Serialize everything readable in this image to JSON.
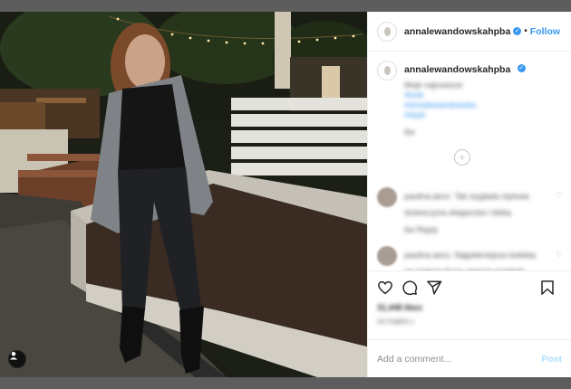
{
  "post": {
    "username": "annalewandowskahpba",
    "follow_separator": "•",
    "follow_label": "Follow",
    "caption_blurred": "Moje najnowsze",
    "hashtags_blurred": [
      "#look",
      "#annalewandowska",
      "#style"
    ],
    "caption_time_blurred": "6w"
  },
  "comments": [
    {
      "user_blurred": "paulina.aeco",
      "text_blurred": "Tak wyglada stylowa dziewczyna elegancka i lekka",
      "meta_blurred": "6w  Reply"
    },
    {
      "user_blurred": "paulina.aeco",
      "text_blurred": "Najpiekniejsza kobieta na swiecie Anna zawsze wyglada idealnie",
      "meta_blurred": ""
    }
  ],
  "likes_blurred": "31,448 likes",
  "date_blurred": "OCTOBER 2",
  "add_comment_placeholder": "Add a comment...",
  "post_label": "Post",
  "colors": {
    "accent": "#3897f0",
    "post_disabled": "#b2dffc",
    "backdrop": "#5d5d5d"
  },
  "icons": [
    "user-tag-icon",
    "heart-icon",
    "comment-icon",
    "share-icon",
    "bookmark-icon",
    "verified-badge-icon",
    "load-more-icon"
  ]
}
